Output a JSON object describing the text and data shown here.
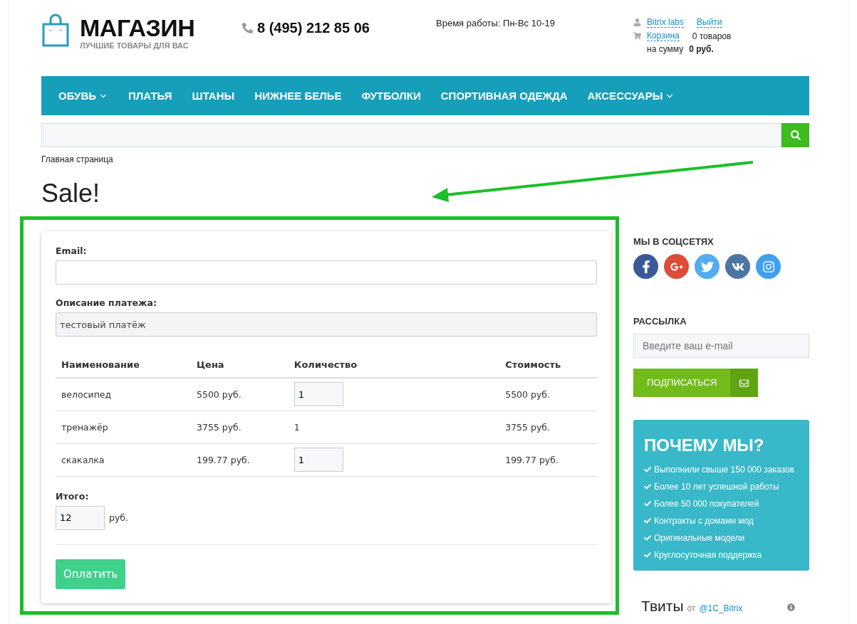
{
  "header": {
    "logo_title": "МАГАЗИН",
    "logo_tagline": "ЛУЧШИЕ ТОВАРЫ ДЛЯ ВАС",
    "phone": "8 (495) 212 85 06",
    "hours": "Время работы: Пн-Вс 10-19",
    "user": "Bitrix labs",
    "logout": "Выйти",
    "cart": "Корзина",
    "cart_count": "0 товаров",
    "cart_sum_label": "на сумму",
    "cart_sum": "0 руб."
  },
  "nav": [
    {
      "label": "ОБУВЬ",
      "dropdown": true
    },
    {
      "label": "ПЛАТЬЯ",
      "dropdown": false
    },
    {
      "label": "ШТАНЫ",
      "dropdown": false
    },
    {
      "label": "НИЖНЕЕ БЕЛЬЕ",
      "dropdown": false
    },
    {
      "label": "ФУТБОЛКИ",
      "dropdown": false
    },
    {
      "label": "СПОРТИВНАЯ ОДЕЖДА",
      "dropdown": false
    },
    {
      "label": "АКСЕССУАРЫ",
      "dropdown": true
    }
  ],
  "breadcrumb": "Главная страница",
  "page_title": "Sale!",
  "form": {
    "email_label": "Email:",
    "description_label": "Описание платежа:",
    "description_value": "тестовый платёж",
    "columns": [
      "Наименование",
      "Цена",
      "Количество",
      "Стоимость"
    ],
    "rows": [
      {
        "name": "велосипед",
        "price": "5500 руб.",
        "quantity": {
          "kind": "input",
          "value": "1"
        },
        "cost": "5500 руб."
      },
      {
        "name": "тренажёр",
        "price": "3755 руб.",
        "quantity": {
          "kind": "text",
          "value": "1"
        },
        "cost": "3755 руб."
      },
      {
        "name": "скакалка",
        "price": "199.77 руб.",
        "quantity": {
          "kind": "input",
          "value": "1"
        },
        "cost": "199.77 руб."
      }
    ],
    "total_label": "Итого:",
    "total_value": "12",
    "total_unit": "руб.",
    "pay_button": "Оплатить"
  },
  "sidebar": {
    "social_title": "МЫ В СОЦСЕТЯХ",
    "social": [
      {
        "kind": "facebook",
        "color": "#3b5998"
      },
      {
        "kind": "google",
        "color": "#dd4b39"
      },
      {
        "kind": "twitter",
        "color": "#55acee"
      },
      {
        "kind": "vk",
        "color": "#4c75a3"
      },
      {
        "kind": "instagram",
        "color": "#3f9ff0"
      }
    ],
    "newsletter_title": "РАССЫЛКА",
    "newsletter_placeholder": "Введите ваш e-mail",
    "subscribe_button": "ПОДПИСАТЬСЯ",
    "why_title": "ПОЧЕМУ МЫ?",
    "why_items": [
      "Выполнили свыше 150 000 заказов",
      "Более 10 лет успешной работы",
      "Более 50 000 покупателей",
      "Контракты с домами мод",
      "Оригинальные модели",
      "Круглосуточная поддержка"
    ],
    "tweets_title": "Твиты",
    "tweets_from": "от",
    "tweets_account": "@1C_Bitrix"
  }
}
